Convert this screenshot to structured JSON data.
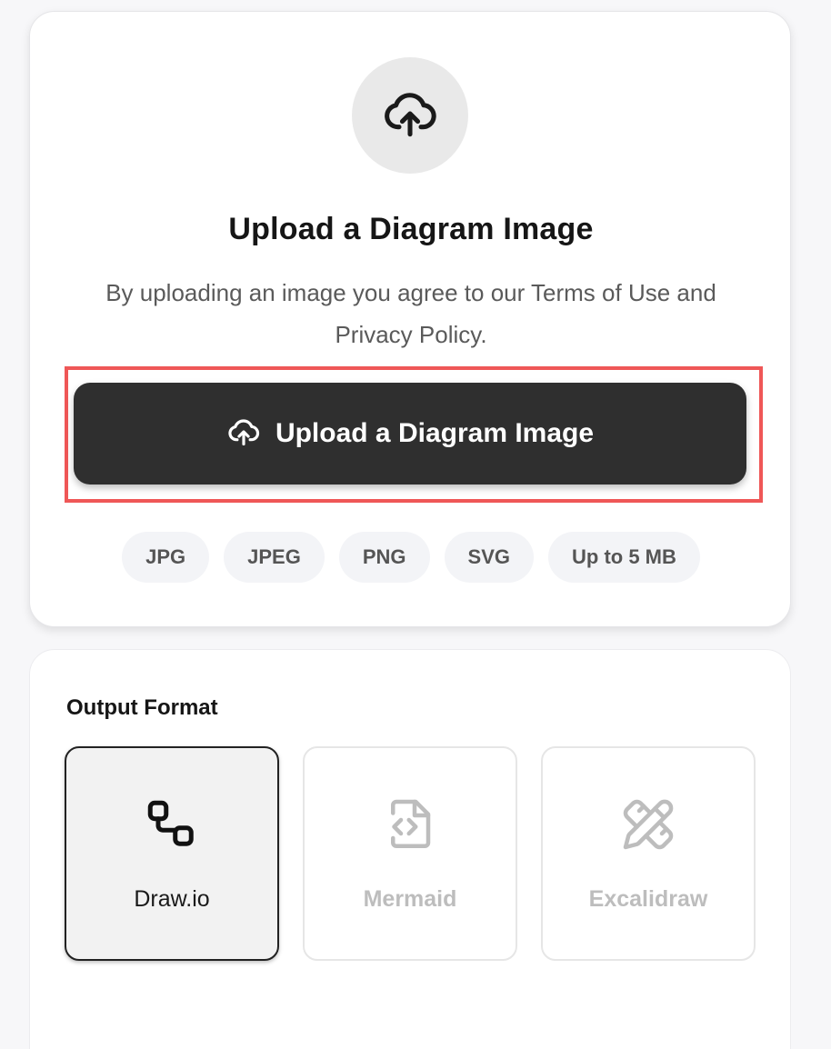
{
  "upload": {
    "title": "Upload a Diagram Image",
    "description": "By uploading an image you agree to our Terms of Use and Privacy Policy.",
    "button_label": "Upload a Diagram Image",
    "formats": [
      "JPG",
      "JPEG",
      "PNG",
      "SVG",
      "Up to 5 MB"
    ]
  },
  "output": {
    "title": "Output Format",
    "options": [
      {
        "label": "Draw.io",
        "icon": "drawio-icon",
        "selected": true
      },
      {
        "label": "Mermaid",
        "icon": "code-file-icon",
        "selected": false
      },
      {
        "label": "Excalidraw",
        "icon": "pencil-ruler-icon",
        "selected": false
      }
    ]
  },
  "colors": {
    "button_bg": "#2f2f2f",
    "highlight_frame": "#ef5757",
    "chip_bg": "#f3f4f7",
    "selected_border": "#222222"
  }
}
